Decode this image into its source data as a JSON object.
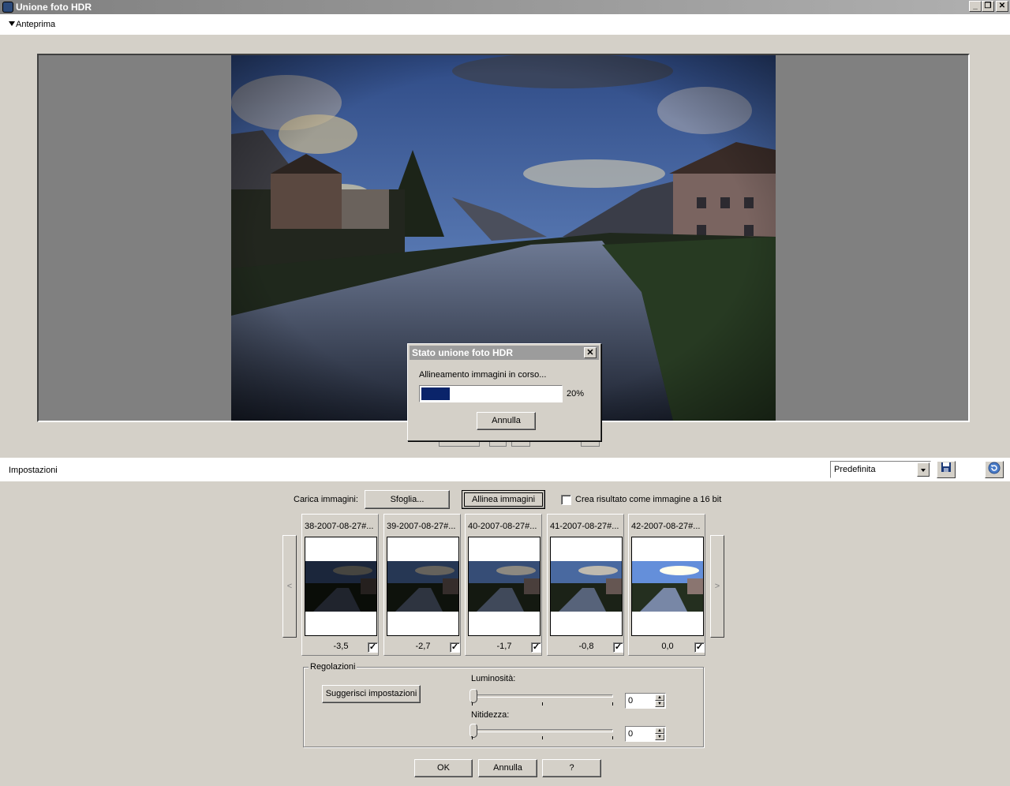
{
  "window": {
    "title": "Unione foto HDR",
    "buttons": {
      "minimize": "_",
      "restore": "❐",
      "close": "✕"
    }
  },
  "preview": {
    "header_label": "Anteprima"
  },
  "progress_dialog": {
    "title": "Stato unione foto HDR",
    "message": "Allineamento immagini in corso...",
    "percent_label": "20%",
    "progress": 0.2,
    "cancel_label": "Annulla",
    "close_glyph": "✕"
  },
  "settings": {
    "header_label": "Impostazioni",
    "preset_value": "Predefinita",
    "save_icon": "floppy-disk-icon",
    "reset_icon": "reset-icon"
  },
  "load": {
    "label": "Carica immagini:",
    "browse_label": "Sfoglia...",
    "align_label": "Allinea immagini",
    "checkbox_16bit_label": "Crea risultato come immagine a 16 bit",
    "checkbox_16bit_checked": false
  },
  "thumbnails": {
    "prev_glyph": "<",
    "next_glyph": ">",
    "items": [
      {
        "name": "38-2007-08-27#...",
        "ev": "-3,5",
        "checked": true,
        "brightness": 0.35
      },
      {
        "name": "39-2007-08-27#...",
        "ev": "-2,7",
        "checked": true,
        "brightness": 0.5
      },
      {
        "name": "40-2007-08-27#...",
        "ev": "-1,7",
        "checked": true,
        "brightness": 0.7
      },
      {
        "name": "41-2007-08-27#...",
        "ev": "-0,8",
        "checked": true,
        "brightness": 0.95
      },
      {
        "name": "42-2007-08-27#...",
        "ev": "0,0",
        "checked": true,
        "brightness": 1.3
      }
    ]
  },
  "adjustments": {
    "group_label": "Regolazioni",
    "suggest_label": "Suggerisci impostazioni",
    "brightness_label": "Luminosità:",
    "brightness_value": "0",
    "sharpness_label": "Nitidezza:",
    "sharpness_value": "0"
  },
  "footer": {
    "ok_label": "OK",
    "cancel_label": "Annulla",
    "help_label": "?"
  },
  "colors": {
    "accent": "#0a246a",
    "face": "#d4d0c8"
  }
}
